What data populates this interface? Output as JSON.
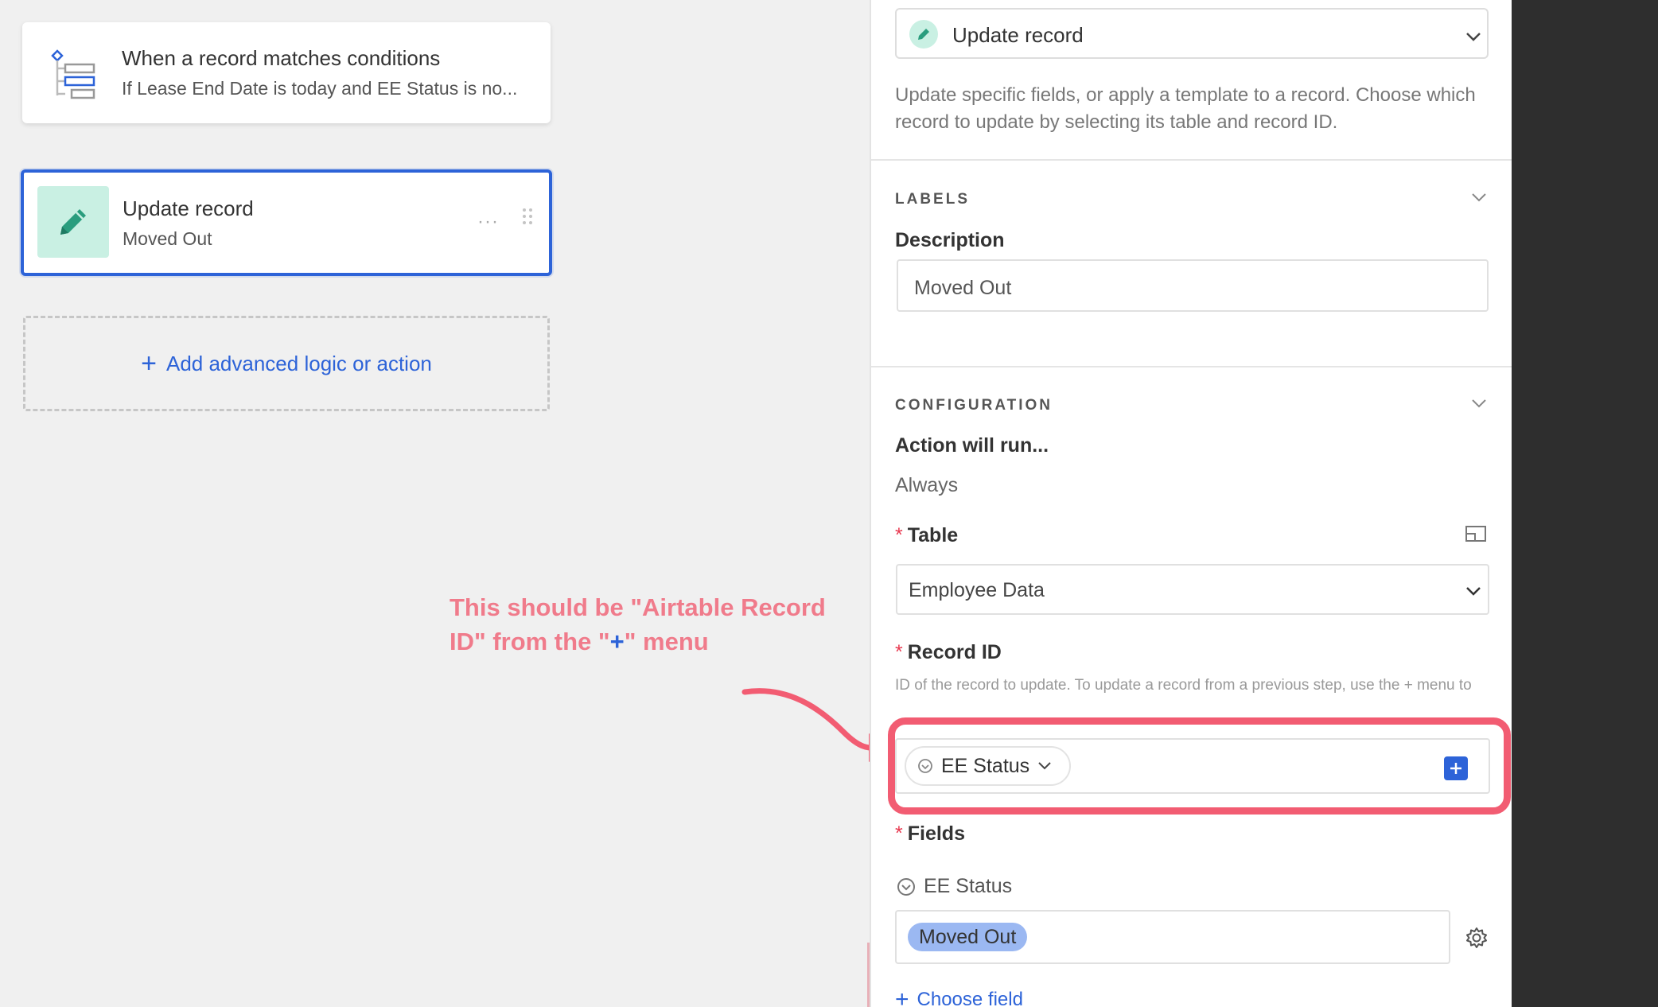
{
  "canvas": {
    "trigger": {
      "title": "When a record matches conditions",
      "subtitle": "If Lease End Date is today and EE Status is no...",
      "icon": "conditions-tree-icon"
    },
    "action": {
      "title": "Update record",
      "subtitle": "Moved Out",
      "more": "···",
      "icon": "pencil-icon"
    },
    "add_action": {
      "label": "Add advanced logic or action"
    },
    "annotation": {
      "line1": "This should be \"Airtable Record",
      "line2_prefix": "ID\" from the \"",
      "line2_plus": "+",
      "line2_suffix": "\" menu",
      "color": "#f07b8b"
    }
  },
  "panel": {
    "action_type": {
      "label": "Update record"
    },
    "action_help": "Update specific fields, or apply a template to a record. Choose which record to update by selecting its table and record ID.",
    "labels_section": {
      "heading": "LABELS",
      "description_label": "Description",
      "description_value": "Moved Out"
    },
    "configuration_section": {
      "heading": "CONFIGURATION",
      "run_label": "Action will run...",
      "run_value": "Always",
      "table_label": "Table",
      "table_value": "Employee Data",
      "record_id_label": "Record ID",
      "record_id_help": "ID of the record to update. To update a record from a previous step, use the + menu to choose the step and its Record ID.",
      "record_id_token": "EE Status",
      "fields_label": "Fields",
      "field_name": "EE Status",
      "field_value": "Moved Out",
      "choose_field": "Choose field"
    }
  },
  "colors": {
    "accent": "#2d63d8",
    "highlight": "#f25c72",
    "action_icon_bg": "#c9f0e3",
    "chip": "#9bb8f2"
  }
}
